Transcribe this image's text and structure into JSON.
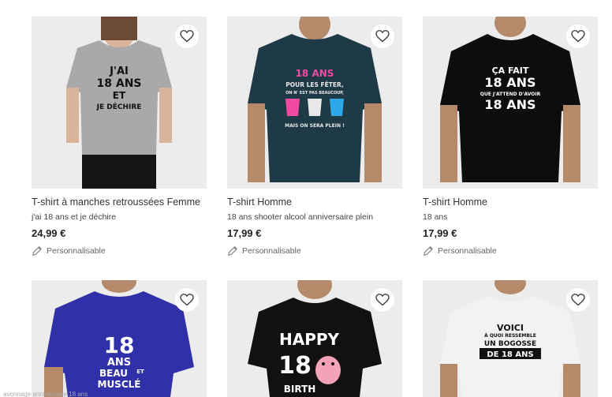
{
  "products": [
    {
      "title": "T-shirt à manches retroussées Femme",
      "subtitle": "j'ai 18 ans et je déchire",
      "price": "24,99 €",
      "customizable": "Personnalisable",
      "print": [
        "J'AI",
        "18 ANS",
        "ET",
        "JE DÉCHIRE"
      ],
      "shirt_color": "#a9a9a9"
    },
    {
      "title": "T-shirt Homme",
      "subtitle": "18 ans shooter alcool anniversaire plein",
      "price": "17,99 €",
      "customizable": "Personnalisable",
      "print": [
        "18 ANS",
        "POUR LES FÊTER,",
        "ON N' EST PAS BEAUCOUP,",
        "MAIS ON SERA PLEIN !"
      ],
      "shirt_color": "#1e3a46"
    },
    {
      "title": "T-shirt Homme",
      "subtitle": "18 ans",
      "price": "17,99 €",
      "customizable": "Personnalisable",
      "print": [
        "ÇA FAIT",
        "18 ANS",
        "QUE J'ATTEND D'AVOIR",
        "18 ANS"
      ],
      "shirt_color": "#0d0d0d"
    },
    {
      "print": [
        "18",
        "ANS",
        "BEAU",
        "ET",
        "MUSCLÉ"
      ],
      "shirt_color": "#3030a8"
    },
    {
      "print": [
        "HAPPY",
        "18",
        "BIRTH"
      ],
      "shirt_color": "#111111"
    },
    {
      "print": [
        "VOICI",
        "À QUOI RESSEMBLE",
        "UN BOGOSSE",
        "DE 18 ANS"
      ],
      "shirt_color": "#f2f2f2"
    }
  ],
  "footer_text": "avonnage anniversaire 18 ans"
}
